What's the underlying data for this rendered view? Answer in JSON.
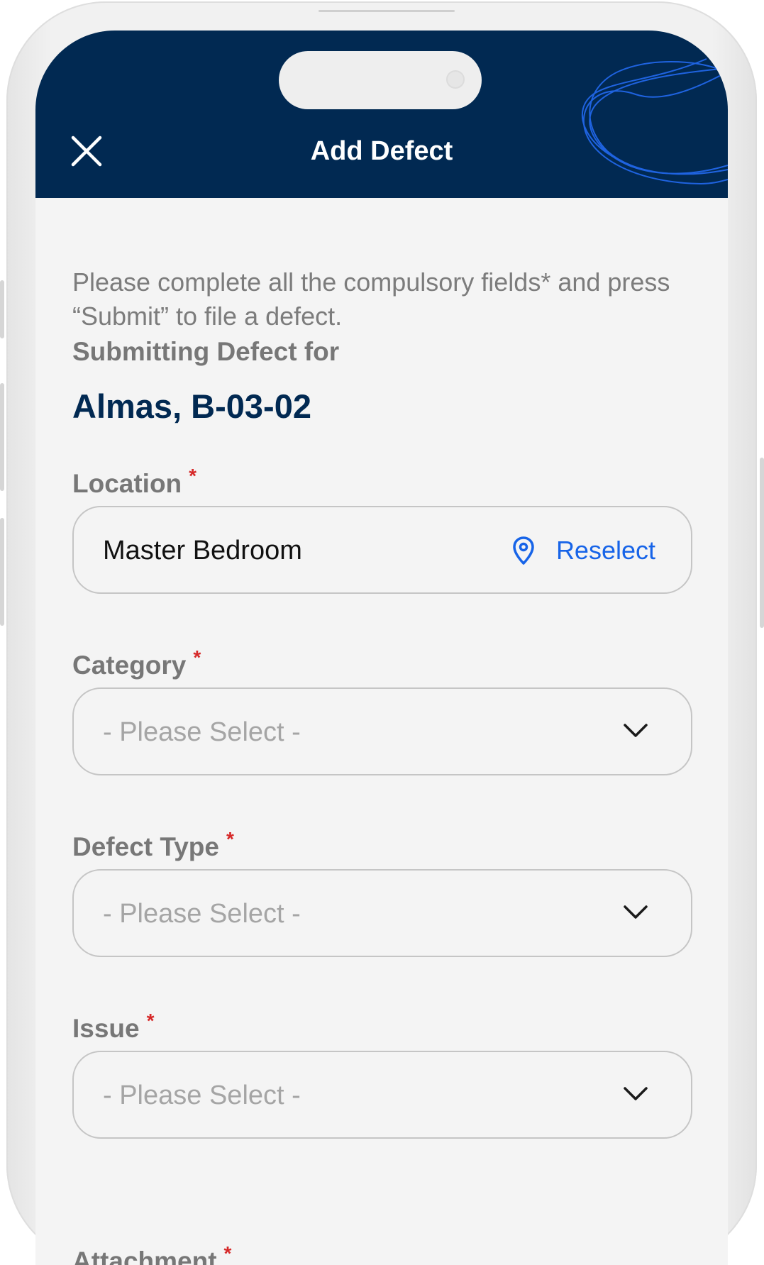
{
  "header": {
    "title": "Add Defect"
  },
  "intro_text": "Please complete all the compulsory fields* and press “Submit” to file a defect.",
  "submitting_for": {
    "label": "Submitting Defect for",
    "unit": "Almas, B-03-02"
  },
  "required_marker": "*",
  "location": {
    "label": "Location",
    "value": "Master Bedroom",
    "reselect_label": "Reselect"
  },
  "category": {
    "label": "Category",
    "placeholder": "- Please Select -"
  },
  "defect_type": {
    "label": "Defect Type",
    "placeholder": "- Please Select -"
  },
  "issue": {
    "label": "Issue",
    "placeholder": "- Please Select -"
  },
  "attachment": {
    "label": "Attachment"
  },
  "colors": {
    "header_bg": "#012952",
    "accent_blue": "#1764e8",
    "required_red": "#d62828"
  }
}
